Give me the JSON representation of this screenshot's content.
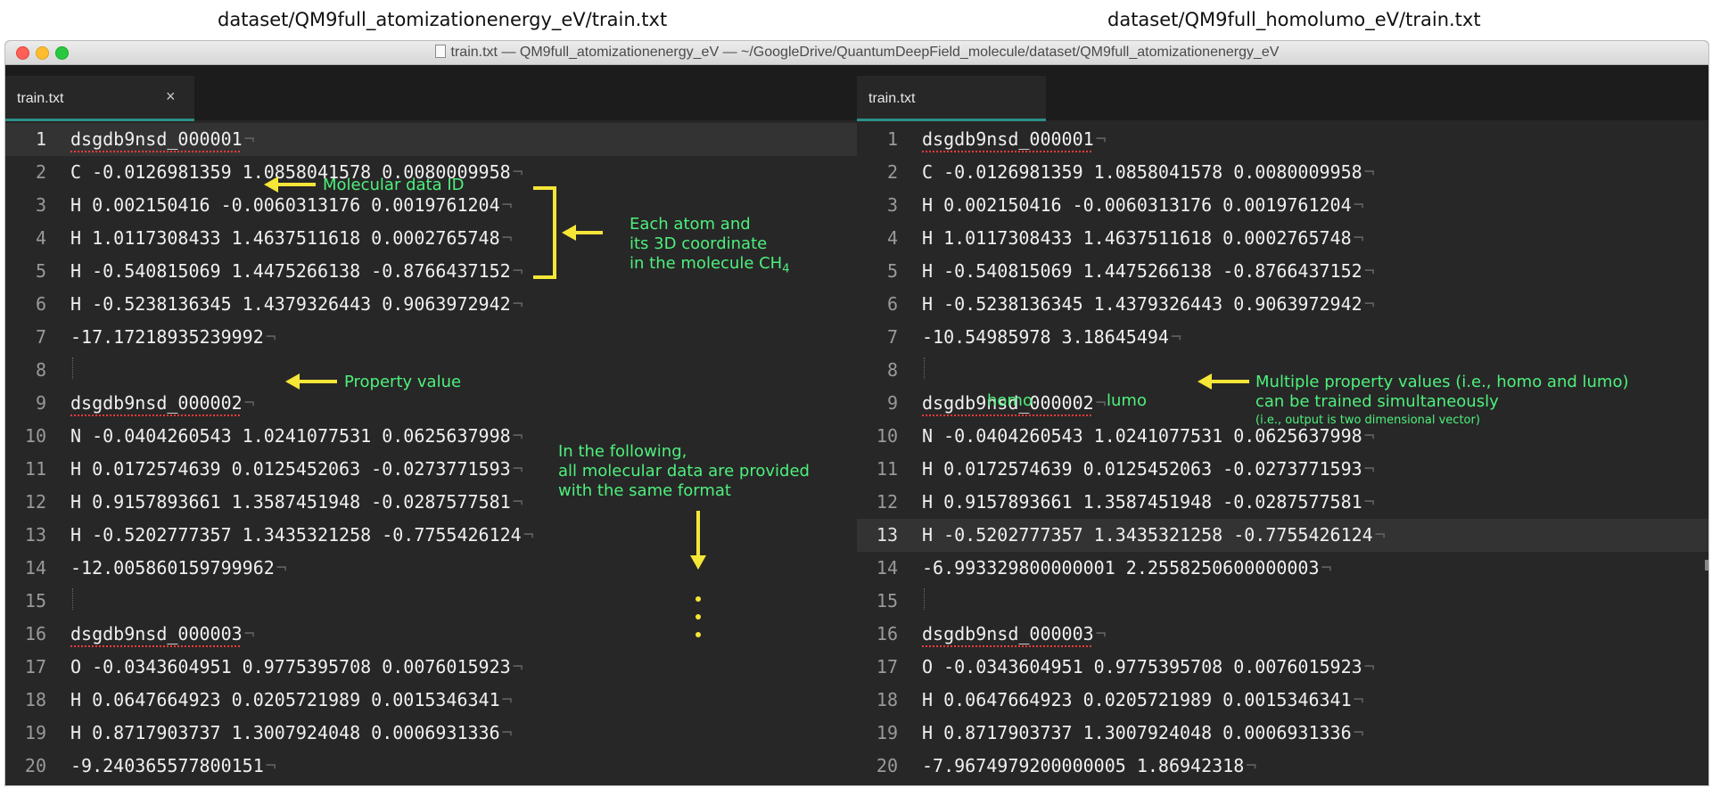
{
  "captions": {
    "left": "dataset/QM9full_atomizationenergy_eV/train.txt",
    "right": "dataset/QM9full_homolumo_eV/train.txt"
  },
  "window": {
    "title": "train.txt — QM9full_atomizationenergy_eV — ~/GoogleDrive/QuantumDeepField_molecule/dataset/QM9full_atomizationenergy_eV"
  },
  "left_pane": {
    "tab": {
      "label": "train.txt",
      "close": "×"
    },
    "active_line": 1,
    "lines": [
      {
        "n": "1",
        "text": "dsgdb9nsd_000001",
        "id": true
      },
      {
        "n": "2",
        "text": "C -0.0126981359 1.0858041578 0.0080009958"
      },
      {
        "n": "3",
        "text": "H 0.002150416 -0.0060313176 0.0019761204"
      },
      {
        "n": "4",
        "text": "H 1.0117308433 1.4637511618 0.0002765748"
      },
      {
        "n": "5",
        "text": "H -0.540815069 1.4475266138 -0.8766437152"
      },
      {
        "n": "6",
        "text": "H -0.5238136345 1.4379326443 0.9063972942"
      },
      {
        "n": "7",
        "text": "-17.17218935239992"
      },
      {
        "n": "8",
        "text": "",
        "blank": true
      },
      {
        "n": "9",
        "text": "dsgdb9nsd_000002",
        "id": true
      },
      {
        "n": "10",
        "text": "N -0.0404260543 1.0241077531 0.0625637998"
      },
      {
        "n": "11",
        "text": "H 0.0172574639 0.0125452063 -0.0273771593"
      },
      {
        "n": "12",
        "text": "H 0.9157893661 1.3587451948 -0.0287577581"
      },
      {
        "n": "13",
        "text": "H -0.5202777357 1.3435321258 -0.7755426124"
      },
      {
        "n": "14",
        "text": "-12.005860159799962"
      },
      {
        "n": "15",
        "text": "",
        "blank": true
      },
      {
        "n": "16",
        "text": "dsgdb9nsd_000003",
        "id": true
      },
      {
        "n": "17",
        "text": "O -0.0343604951 0.9775395708 0.0076015923"
      },
      {
        "n": "18",
        "text": "H 0.0647664923 0.0205721989 0.0015346341"
      },
      {
        "n": "19",
        "text": "H 0.8717903737 1.3007924048 0.0006931336"
      },
      {
        "n": "20",
        "text": "-9.240365577800151"
      }
    ]
  },
  "right_pane": {
    "tab": {
      "label": "train.txt"
    },
    "active_line": 13,
    "lines": [
      {
        "n": "1",
        "text": "dsgdb9nsd_000001",
        "id": true
      },
      {
        "n": "2",
        "text": "C -0.0126981359 1.0858041578 0.0080009958"
      },
      {
        "n": "3",
        "text": "H 0.002150416 -0.0060313176 0.0019761204"
      },
      {
        "n": "4",
        "text": "H 1.0117308433 1.4637511618 0.0002765748"
      },
      {
        "n": "5",
        "text": "H -0.540815069 1.4475266138 -0.8766437152"
      },
      {
        "n": "6",
        "text": "H -0.5238136345 1.4379326443 0.9063972942"
      },
      {
        "n": "7",
        "text": "-10.54985978 3.18645494"
      },
      {
        "n": "8",
        "text": "",
        "blank": true
      },
      {
        "n": "9",
        "text": "dsgdb9nsd_000002",
        "id": true
      },
      {
        "n": "10",
        "text": "N -0.0404260543 1.0241077531 0.0625637998"
      },
      {
        "n": "11",
        "text": "H 0.0172574639 0.0125452063 -0.0273771593"
      },
      {
        "n": "12",
        "text": "H 0.9157893661 1.3587451948 -0.0287577581"
      },
      {
        "n": "13",
        "text": "H -0.5202777357 1.3435321258 -0.7755426124"
      },
      {
        "n": "14",
        "text": "-6.993329800000001 2.2558250600000003"
      },
      {
        "n": "15",
        "text": "",
        "blank": true
      },
      {
        "n": "16",
        "text": "dsgdb9nsd_000003",
        "id": true
      },
      {
        "n": "17",
        "text": "O -0.0343604951 0.9775395708 0.0076015923"
      },
      {
        "n": "18",
        "text": "H 0.0647664923 0.0205721989 0.0015346341"
      },
      {
        "n": "19",
        "text": "H 0.8717903737 1.3007924048 0.0006931336"
      },
      {
        "n": "20",
        "text": "-7.9674979200000005 1.86942318"
      }
    ]
  },
  "annotations": {
    "molecular_id": "Molecular data ID",
    "atoms_line1": "Each atom and",
    "atoms_line2": "its 3D coordinate",
    "atoms_line3_prefix": "in the molecule CH",
    "atoms_line3_sub": "4",
    "property": "Property value",
    "following_line1": "In the following,",
    "following_line2": "all molecular data are provided",
    "following_line3": "with the same format",
    "multi_line1": "Multiple property values (i.e., homo and lumo)",
    "multi_line2": "can be trained simultaneously",
    "multi_line3": "(i.e., output is two dimensional vector)",
    "homo": "homo",
    "lumo": "lumo"
  },
  "colors": {
    "annotation_text": "#4ef07c",
    "arrow": "#f5e637",
    "tab_underline": "#2d8f86",
    "editor_bg": "#272727",
    "id_underline": "#ff3b3b"
  },
  "eol_glyph": "¬"
}
